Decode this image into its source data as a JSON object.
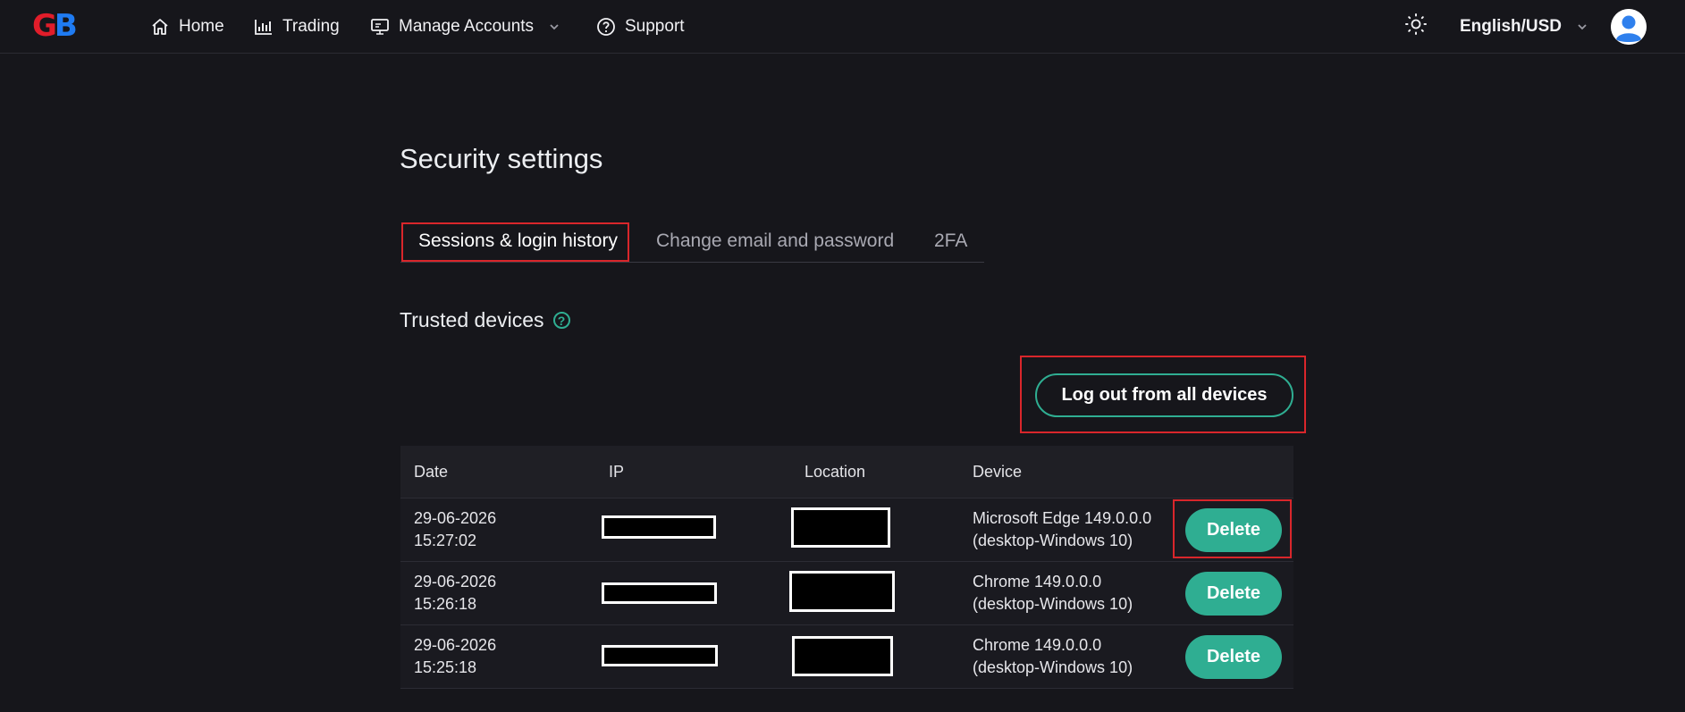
{
  "header": {
    "logo_g": "G",
    "logo_b": "B",
    "nav": [
      {
        "label": "Home",
        "icon": "home-icon"
      },
      {
        "label": "Trading",
        "icon": "chart-icon"
      },
      {
        "label": "Manage Accounts",
        "icon": "monitor-icon"
      },
      {
        "label": "Support",
        "icon": "help-circle-icon"
      }
    ],
    "language": "English/USD"
  },
  "page": {
    "title": "Security settings",
    "tabs": [
      {
        "label": "Sessions & login history",
        "active": true
      },
      {
        "label": "Change email and password",
        "active": false
      },
      {
        "label": "2FA",
        "active": false
      }
    ],
    "trusted_devices_title": "Trusted devices",
    "help_glyph": "?",
    "logout_all_label": "Log out from all devices"
  },
  "table": {
    "headers": [
      "Date",
      "IP",
      "Location",
      "Device"
    ],
    "rows": [
      {
        "date": "29-06-2026",
        "time": "15:27:02",
        "device": "Microsoft Edge 149.0.0.0",
        "device_os": "(desktop-Windows 10)",
        "action": "Delete"
      },
      {
        "date": "29-06-2026",
        "time": "15:26:18",
        "device": "Chrome 149.0.0.0",
        "device_os": "(desktop-Windows 10)",
        "action": "Delete"
      },
      {
        "date": "29-06-2026",
        "time": "15:25:18",
        "device": "Chrome 149.0.0.0",
        "device_os": "(desktop-Windows 10)",
        "action": "Delete"
      }
    ]
  },
  "colors": {
    "background": "#16161b",
    "accent": "#2fae92",
    "highlight": "#d9262b",
    "logo_red": "#e11d2a",
    "logo_blue": "#1f7bf2"
  }
}
